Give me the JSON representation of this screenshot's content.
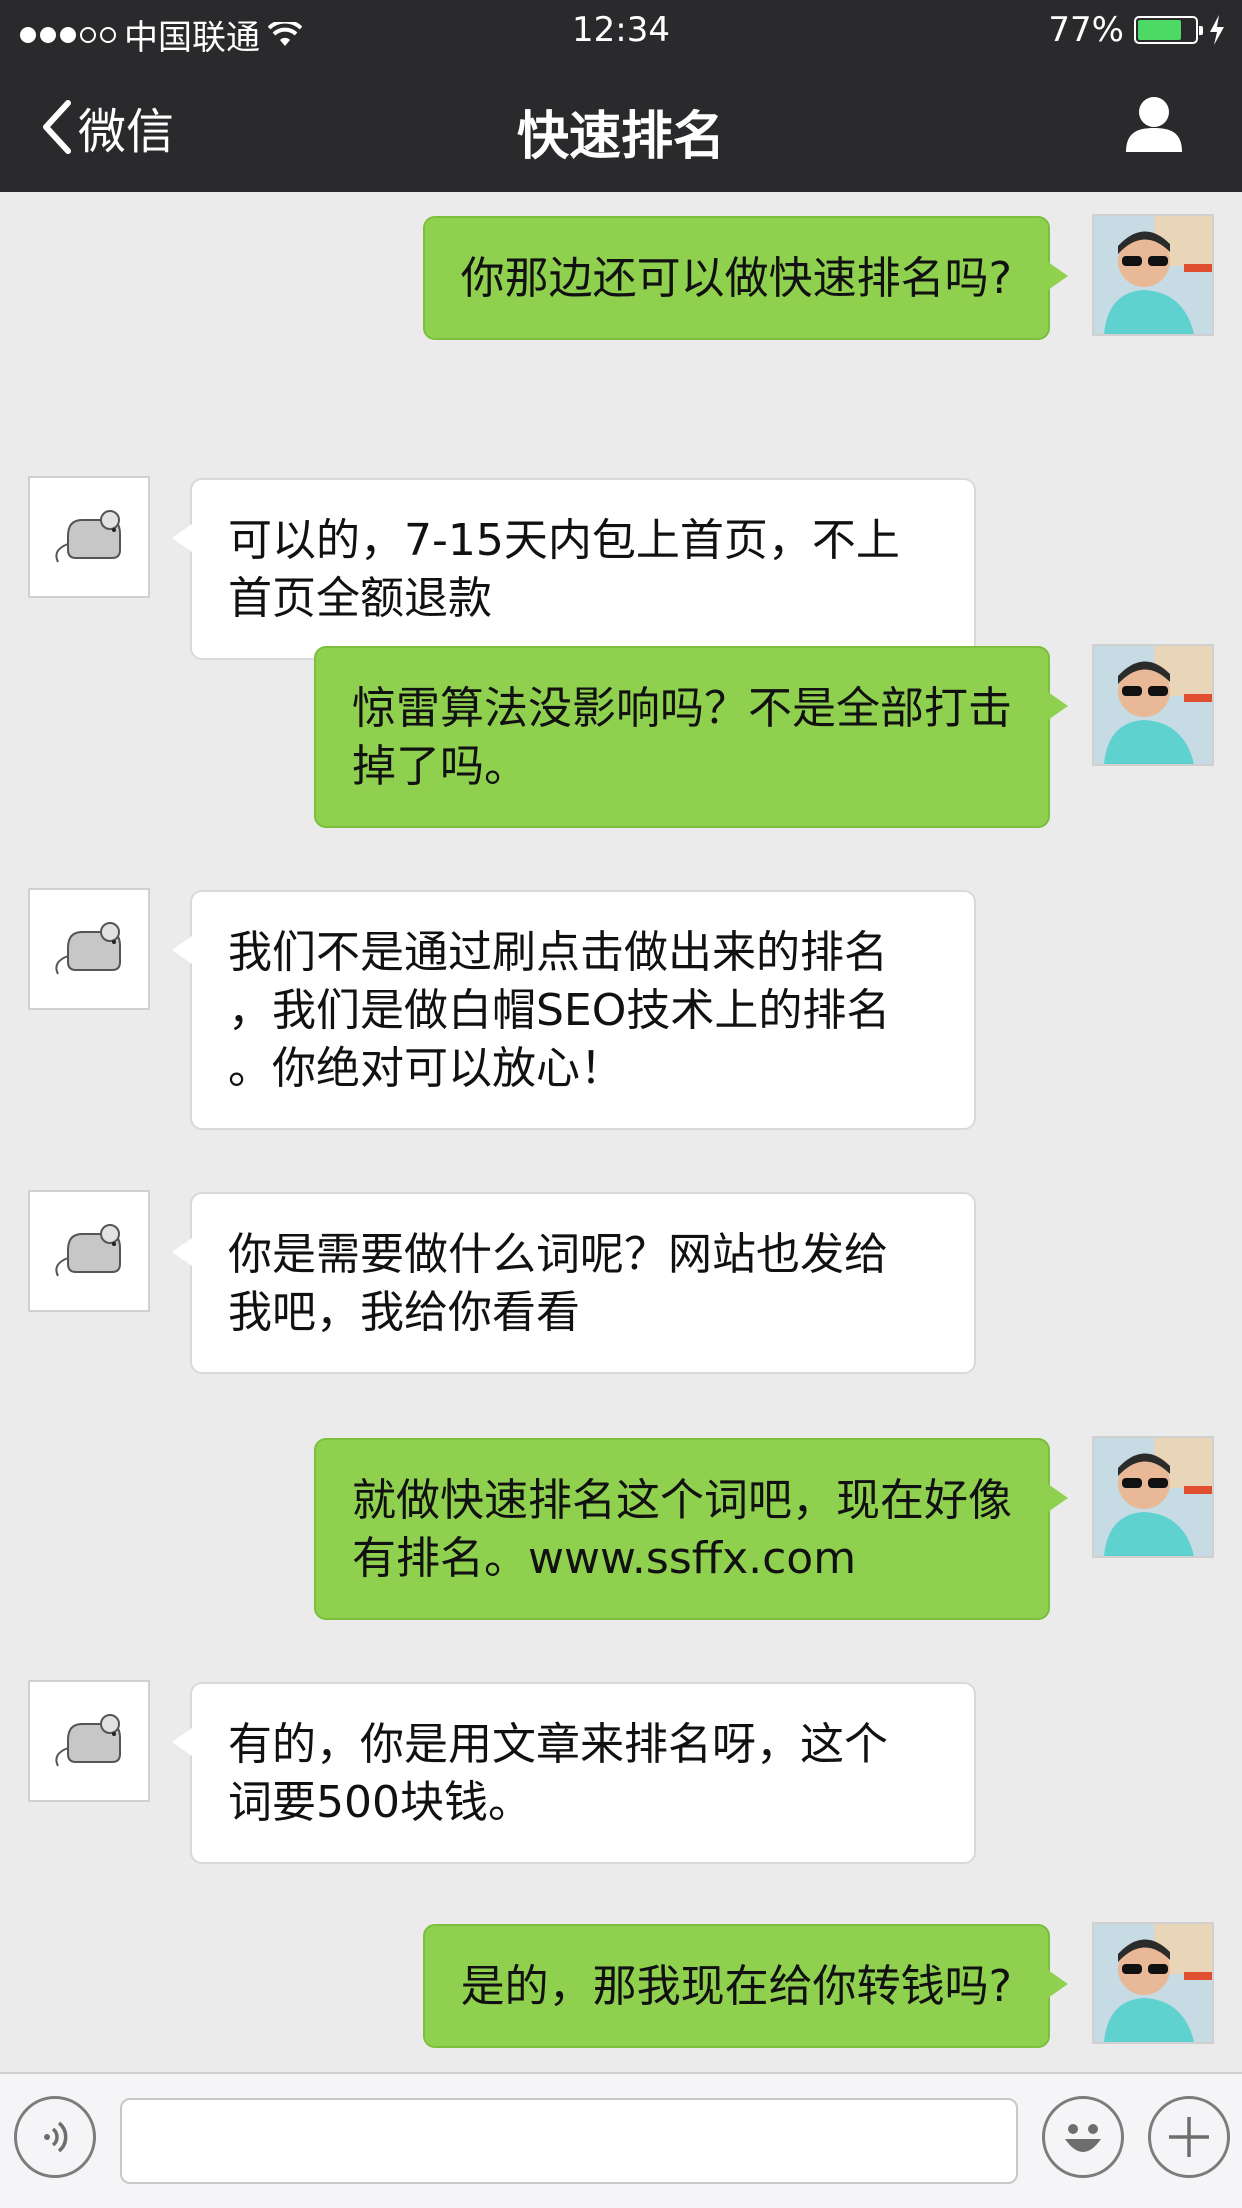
{
  "status_bar": {
    "carrier": "中国联通",
    "time": "12:34",
    "battery_percent": "77%",
    "battery_level": 0.77
  },
  "nav": {
    "back_label": "微信",
    "title": "快速排名"
  },
  "messages": [
    {
      "sender": "me",
      "text": "你那边还可以做快速排名吗?"
    },
    {
      "sender": "other",
      "text": "可以的，7-15天内包上首页，不上\n首页全额退款"
    },
    {
      "sender": "me",
      "text": "惊雷算法没影响吗？不是全部打击\n掉了吗。"
    },
    {
      "sender": "other",
      "text": "我们不是通过刷点击做出来的排名\n，我们是做白帽SEO技术上的排名\n。你绝对可以放心！"
    },
    {
      "sender": "other",
      "text": "你是需要做什么词呢？网站也发给\n我吧，我给你看看"
    },
    {
      "sender": "me",
      "text": "就做快速排名这个词吧，现在好像\n有排名。www.ssffx.com"
    },
    {
      "sender": "other",
      "text": "有的，你是用文章来排名呀，这个\n词要500块钱。"
    },
    {
      "sender": "me",
      "text": "是的，那我现在给你转钱吗?"
    }
  ],
  "input_bar": {
    "text_value": "",
    "icons": [
      "voice-icon",
      "emoji-icon",
      "plus-icon"
    ]
  },
  "colors": {
    "bar_bg": "#2a2a2c",
    "chat_bg": "#ebebeb",
    "me_bubble": "#8fd14f",
    "other_bubble": "#ffffff"
  }
}
